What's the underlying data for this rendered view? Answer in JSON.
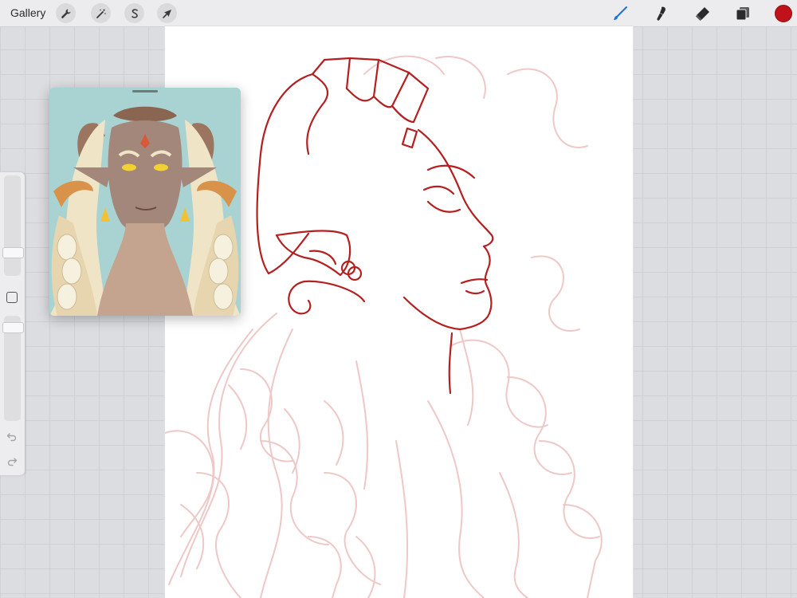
{
  "toolbar": {
    "gallery_label": "Gallery",
    "left_tools": [
      {
        "name": "actions",
        "icon": "wrench-icon"
      },
      {
        "name": "adjustments",
        "icon": "magic-wand-icon"
      },
      {
        "name": "selection",
        "icon": "selection-s-icon"
      },
      {
        "name": "transform",
        "icon": "arrow-cursor-icon"
      }
    ],
    "right_tools": [
      {
        "name": "brush",
        "icon": "brush-icon",
        "active": true
      },
      {
        "name": "smudge",
        "icon": "smudge-icon"
      },
      {
        "name": "eraser",
        "icon": "eraser-icon"
      },
      {
        "name": "layers",
        "icon": "layers-icon"
      }
    ],
    "current_color": "#c1121b",
    "active_tool_color": "#1a73d9"
  },
  "sidebar": {
    "brush_size_slider_icon": "slider-icon",
    "opacity_slider_icon": "slider-icon",
    "modify_button_icon": "square-icon",
    "undo_icon": "undo-icon",
    "redo_icon": "redo-icon"
  },
  "reference_window": {
    "background_color": "#a9d3d2",
    "icon": "reference-image"
  },
  "canvas": {
    "stroke_color": "#b51f1f",
    "sketch_color": "#e8b8b6"
  }
}
